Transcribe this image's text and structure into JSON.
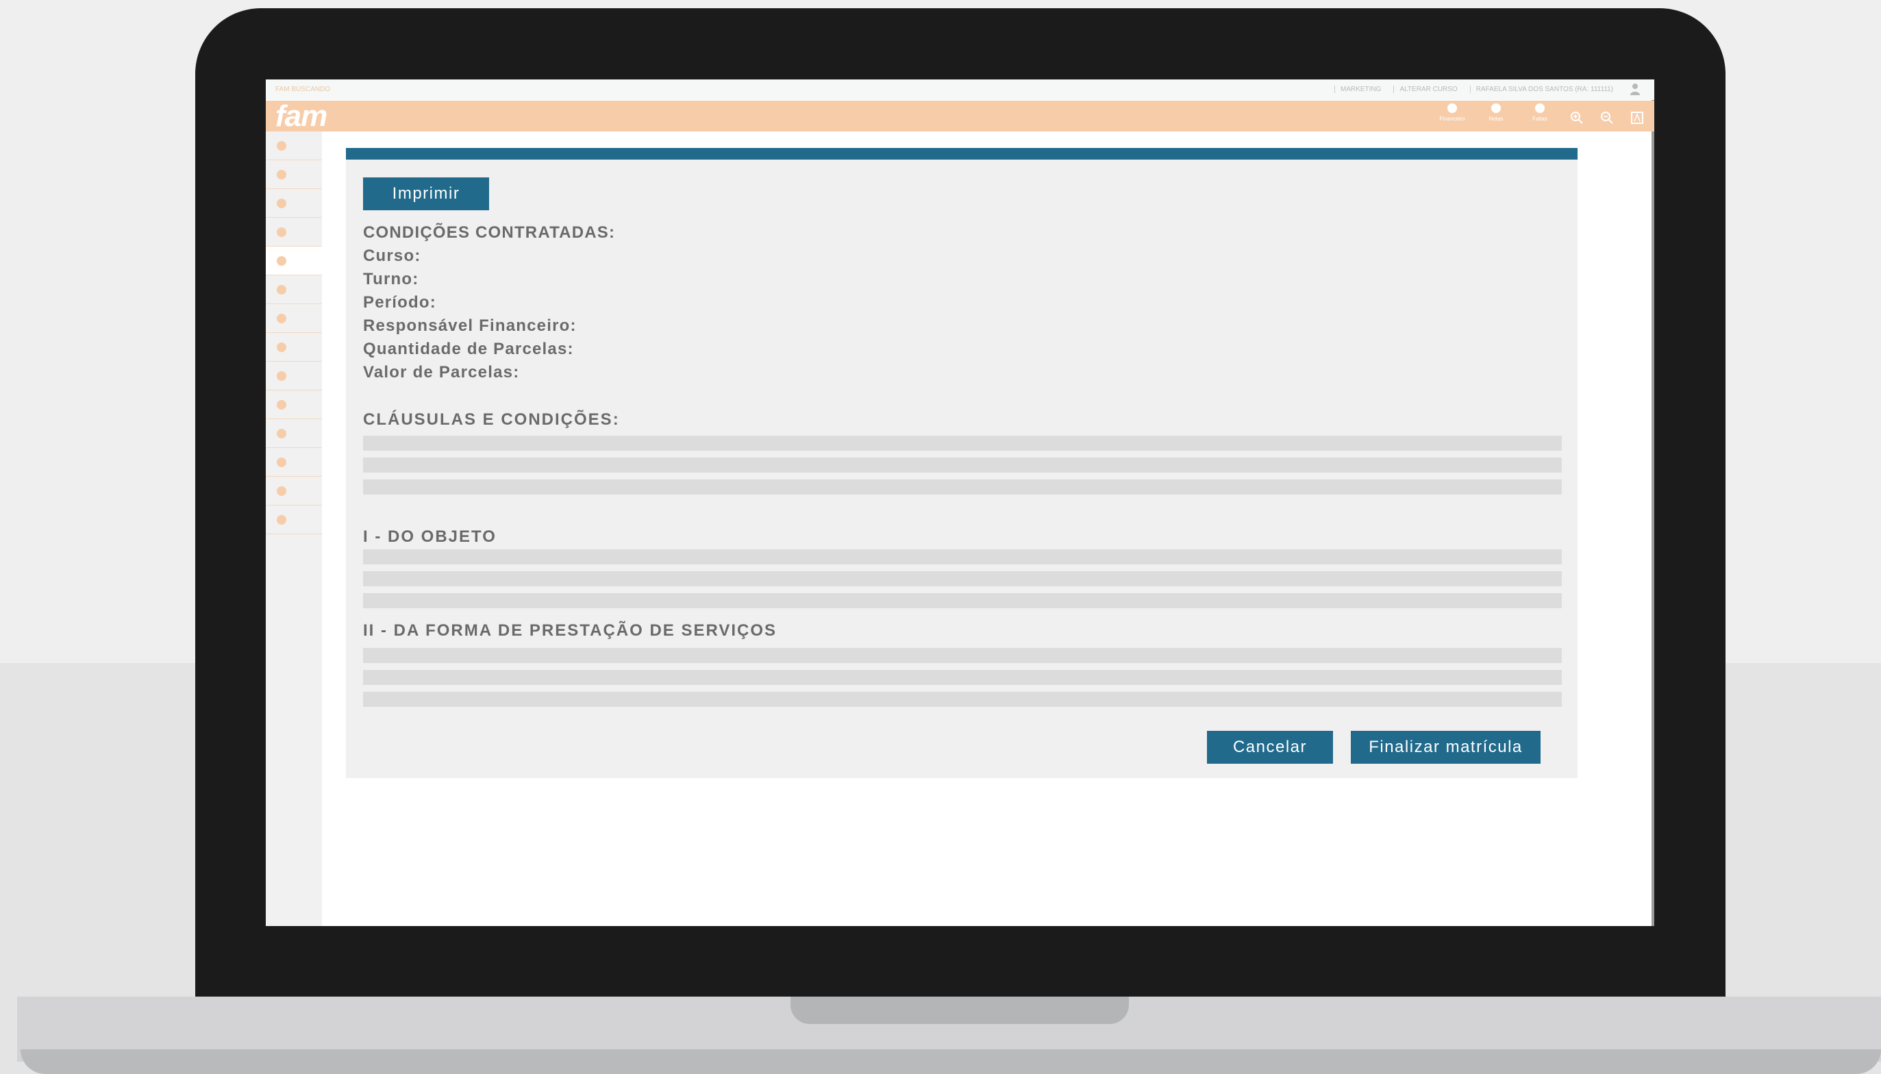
{
  "topbar": {
    "system_name": "FAM BUSCANDO",
    "links": [
      "MARKETING",
      "ALTERAR CURSO",
      "RAFAELA SILVA DOS SANTOS (RA: 111111)"
    ]
  },
  "header": {
    "logo_text": "fam",
    "tools": [
      {
        "label": "Financeiro",
        "icon": "dot-icon"
      },
      {
        "label": "Notas",
        "icon": "dot-icon"
      },
      {
        "label": "Faltas",
        "icon": "dot-icon"
      }
    ],
    "accessibility_icons": [
      "zoom-in-icon",
      "zoom-out-icon",
      "contrast-icon"
    ]
  },
  "sidebar": {
    "item_count": 14,
    "active_index": 4
  },
  "contract": {
    "print_label": "Imprimir",
    "conditions_heading": "CONDIÇÕES CONTRATADAS:",
    "fields": [
      "Curso:",
      "Turno:",
      "Período:",
      "Responsável Financeiro:",
      "Quantidade de Parcelas:",
      "Valor de Parcelas:"
    ],
    "clauses_heading": "CLÁUSULAS E CONDIÇÕES:",
    "section1_heading": "I - DO OBJETO",
    "section2_heading": "II - DA FORMA DE PRESTAÇÃO DE SERVIÇOS",
    "cancel_label": "Cancelar",
    "finish_label": "Finalizar matrícula"
  },
  "colors": {
    "accent": "#216a8b",
    "brand_orange": "#f7cca9",
    "panel_bg": "#f0f0f0",
    "text": "#6a6a6a"
  }
}
